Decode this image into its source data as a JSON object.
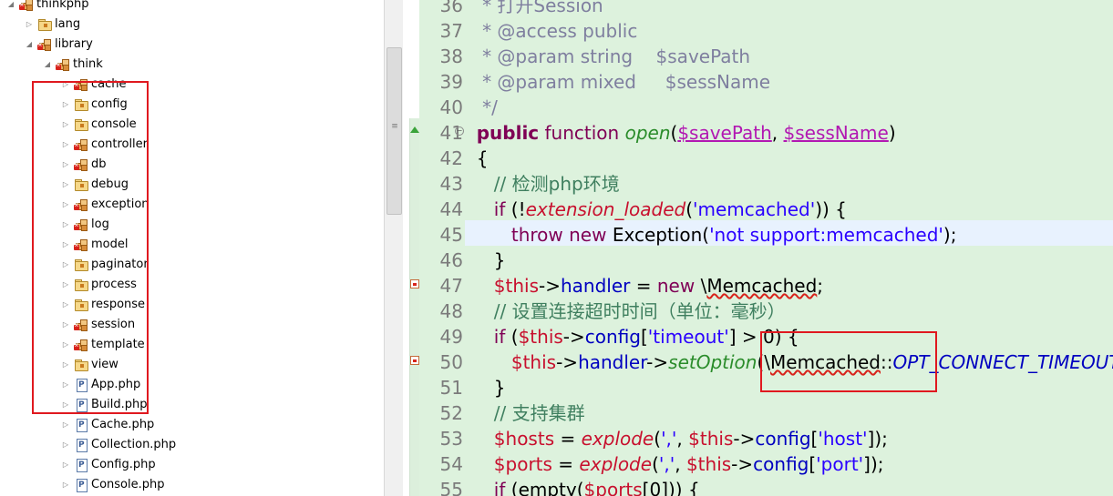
{
  "tree": {
    "rows": [
      {
        "label": "thinkphp",
        "twisty": "◢",
        "icon": "package",
        "error": true,
        "level": 0
      },
      {
        "label": "lang",
        "twisty": "▷",
        "icon": "folder",
        "error": false,
        "level": 1
      },
      {
        "label": "library",
        "twisty": "◢",
        "icon": "package",
        "error": true,
        "level": 1
      },
      {
        "label": "think",
        "twisty": "◢",
        "icon": "package",
        "error": true,
        "level": 2
      },
      {
        "label": "cache",
        "twisty": "▷",
        "icon": "package",
        "error": true,
        "level": 3
      },
      {
        "label": "config",
        "twisty": "▷",
        "icon": "folder",
        "error": false,
        "level": 3
      },
      {
        "label": "console",
        "twisty": "▷",
        "icon": "folder",
        "error": false,
        "level": 3
      },
      {
        "label": "controller",
        "twisty": "▷",
        "icon": "package",
        "error": true,
        "level": 3
      },
      {
        "label": "db",
        "twisty": "▷",
        "icon": "package",
        "error": true,
        "level": 3
      },
      {
        "label": "debug",
        "twisty": "▷",
        "icon": "folder",
        "error": false,
        "level": 3
      },
      {
        "label": "exception",
        "twisty": "▷",
        "icon": "package",
        "error": true,
        "level": 3
      },
      {
        "label": "log",
        "twisty": "▷",
        "icon": "package",
        "error": true,
        "level": 3
      },
      {
        "label": "model",
        "twisty": "▷",
        "icon": "package",
        "error": true,
        "level": 3
      },
      {
        "label": "paginator",
        "twisty": "▷",
        "icon": "folder",
        "error": false,
        "level": 3
      },
      {
        "label": "process",
        "twisty": "▷",
        "icon": "folder",
        "error": false,
        "level": 3
      },
      {
        "label": "response",
        "twisty": "▷",
        "icon": "folder",
        "error": false,
        "level": 3
      },
      {
        "label": "session",
        "twisty": "▷",
        "icon": "package",
        "error": true,
        "level": 3
      },
      {
        "label": "template",
        "twisty": "▷",
        "icon": "package",
        "error": true,
        "level": 3
      },
      {
        "label": "view",
        "twisty": "▷",
        "icon": "folder",
        "error": false,
        "level": 3
      },
      {
        "label": "App.php",
        "twisty": "▷",
        "icon": "php-file",
        "error": false,
        "level": 3
      },
      {
        "label": "Build.php",
        "twisty": "▷",
        "icon": "php-file",
        "error": false,
        "level": 3
      },
      {
        "label": "Cache.php",
        "twisty": "▷",
        "icon": "php-file",
        "error": false,
        "level": 3
      },
      {
        "label": "Collection.php",
        "twisty": "▷",
        "icon": "php-file",
        "error": false,
        "level": 3
      },
      {
        "label": "Config.php",
        "twisty": "▷",
        "icon": "php-file",
        "error": false,
        "level": 3
      },
      {
        "label": "Console.php",
        "twisty": "▷",
        "icon": "php-file",
        "error": false,
        "level": 3
      }
    ]
  },
  "editor": {
    "lines": [
      {
        "n": "36",
        "tokens": [
          {
            "t": "   * 打开Session",
            "c": "c-comd"
          }
        ]
      },
      {
        "n": "37",
        "tokens": [
          {
            "t": "   * @access public",
            "c": "c-comd"
          }
        ]
      },
      {
        "n": "38",
        "tokens": [
          {
            "t": "   * @param string    $savePath",
            "c": "c-comd"
          }
        ]
      },
      {
        "n": "39",
        "tokens": [
          {
            "t": "   * @param mixed     $sessName",
            "c": "c-comd"
          }
        ]
      },
      {
        "n": "40",
        "tokens": [
          {
            "t": "   */",
            "c": "c-comd"
          }
        ]
      },
      {
        "n": "41",
        "tokens": [
          {
            "t": "  ",
            "c": "c-pl"
          },
          {
            "t": "public",
            "c": "c-kw"
          },
          {
            "t": " ",
            "c": "c-pl"
          },
          {
            "t": "function",
            "c": "c-kw2"
          },
          {
            "t": " ",
            "c": "c-pl"
          },
          {
            "t": "open",
            "c": "c-fn"
          },
          {
            "t": "(",
            "c": "c-pl"
          },
          {
            "t": "$savePath",
            "c": "c-var"
          },
          {
            "t": ", ",
            "c": "c-pl"
          },
          {
            "t": "$sessName",
            "c": "c-var"
          },
          {
            "t": ")",
            "c": "c-pl"
          }
        ]
      },
      {
        "n": "42",
        "tokens": [
          {
            "t": "  {",
            "c": "c-pl"
          }
        ]
      },
      {
        "n": "43",
        "tokens": [
          {
            "t": "     ",
            "c": "c-pl"
          },
          {
            "t": "// 检测php环境",
            "c": "c-com"
          }
        ]
      },
      {
        "n": "44",
        "tokens": [
          {
            "t": "     ",
            "c": "c-pl"
          },
          {
            "t": "if",
            "c": "c-kw2"
          },
          {
            "t": " (!",
            "c": "c-pl"
          },
          {
            "t": "extension_loaded",
            "c": "c-call"
          },
          {
            "t": "(",
            "c": "c-pl"
          },
          {
            "t": "'memcached'",
            "c": "c-str"
          },
          {
            "t": ")) {",
            "c": "c-pl"
          }
        ]
      },
      {
        "n": "45",
        "tokens": [
          {
            "t": "        ",
            "c": "c-pl"
          },
          {
            "t": "throw",
            "c": "c-kw2"
          },
          {
            "t": " ",
            "c": "c-pl"
          },
          {
            "t": "new",
            "c": "c-kw2"
          },
          {
            "t": " Exception(",
            "c": "c-pl"
          },
          {
            "t": "'not support:memcached'",
            "c": "c-str"
          },
          {
            "t": ");",
            "c": "c-pl"
          }
        ]
      },
      {
        "n": "46",
        "tokens": [
          {
            "t": "     }",
            "c": "c-pl"
          }
        ]
      },
      {
        "n": "47",
        "tokens": [
          {
            "t": "     ",
            "c": "c-pl"
          },
          {
            "t": "$this",
            "c": "c-this"
          },
          {
            "t": "->",
            "c": "c-pl"
          },
          {
            "t": "handler",
            "c": "c-prop"
          },
          {
            "t": " = ",
            "c": "c-pl"
          },
          {
            "t": "new",
            "c": "c-kw2"
          },
          {
            "t": " \\",
            "c": "c-pl"
          },
          {
            "t": "Memcached",
            "c": "c-pl c-warn"
          },
          {
            "t": ";",
            "c": "c-pl"
          }
        ]
      },
      {
        "n": "48",
        "tokens": [
          {
            "t": "     ",
            "c": "c-pl"
          },
          {
            "t": "// 设置连接超时时间（单位：毫秒）",
            "c": "c-com"
          }
        ]
      },
      {
        "n": "49",
        "tokens": [
          {
            "t": "     ",
            "c": "c-pl"
          },
          {
            "t": "if",
            "c": "c-kw2"
          },
          {
            "t": " (",
            "c": "c-pl"
          },
          {
            "t": "$this",
            "c": "c-this"
          },
          {
            "t": "->",
            "c": "c-pl"
          },
          {
            "t": "config",
            "c": "c-prop"
          },
          {
            "t": "[",
            "c": "c-pl"
          },
          {
            "t": "'timeout'",
            "c": "c-str"
          },
          {
            "t": "] > 0) {",
            "c": "c-pl"
          }
        ]
      },
      {
        "n": "50",
        "tokens": [
          {
            "t": "        ",
            "c": "c-pl"
          },
          {
            "t": "$this",
            "c": "c-this"
          },
          {
            "t": "->",
            "c": "c-pl"
          },
          {
            "t": "handler",
            "c": "c-prop"
          },
          {
            "t": "->",
            "c": "c-pl"
          },
          {
            "t": "setOption",
            "c": "c-fn"
          },
          {
            "t": "(\\",
            "c": "c-pl"
          },
          {
            "t": "Memcached",
            "c": "c-pl c-warn"
          },
          {
            "t": "::",
            "c": "c-pl"
          },
          {
            "t": "OPT_CONNECT_TIMEOUT",
            "c": "c-const"
          }
        ]
      },
      {
        "n": "51",
        "tokens": [
          {
            "t": "     }",
            "c": "c-pl"
          }
        ]
      },
      {
        "n": "52",
        "tokens": [
          {
            "t": "     ",
            "c": "c-pl"
          },
          {
            "t": "// 支持集群",
            "c": "c-com"
          }
        ]
      },
      {
        "n": "53",
        "tokens": [
          {
            "t": "     ",
            "c": "c-pl"
          },
          {
            "t": "$hosts",
            "c": "c-this"
          },
          {
            "t": " = ",
            "c": "c-pl"
          },
          {
            "t": "explode",
            "c": "c-call"
          },
          {
            "t": "(",
            "c": "c-pl"
          },
          {
            "t": "','",
            "c": "c-str"
          },
          {
            "t": ", ",
            "c": "c-pl"
          },
          {
            "t": "$this",
            "c": "c-this"
          },
          {
            "t": "->",
            "c": "c-pl"
          },
          {
            "t": "config",
            "c": "c-prop"
          },
          {
            "t": "[",
            "c": "c-pl"
          },
          {
            "t": "'host'",
            "c": "c-str"
          },
          {
            "t": "]);",
            "c": "c-pl"
          }
        ]
      },
      {
        "n": "54",
        "tokens": [
          {
            "t": "     ",
            "c": "c-pl"
          },
          {
            "t": "$ports",
            "c": "c-this"
          },
          {
            "t": " = ",
            "c": "c-pl"
          },
          {
            "t": "explode",
            "c": "c-call"
          },
          {
            "t": "(",
            "c": "c-pl"
          },
          {
            "t": "','",
            "c": "c-str"
          },
          {
            "t": ", ",
            "c": "c-pl"
          },
          {
            "t": "$this",
            "c": "c-this"
          },
          {
            "t": "->",
            "c": "c-pl"
          },
          {
            "t": "config",
            "c": "c-prop"
          },
          {
            "t": "[",
            "c": "c-pl"
          },
          {
            "t": "'port'",
            "c": "c-str"
          },
          {
            "t": "]);",
            "c": "c-pl"
          }
        ]
      },
      {
        "n": "55",
        "tokens": [
          {
            "t": "     ",
            "c": "c-pl"
          },
          {
            "t": "if",
            "c": "c-kw2"
          },
          {
            "t": " (empty(",
            "c": "c-pl"
          },
          {
            "t": "$ports",
            "c": "c-this"
          },
          {
            "t": "[0])) {",
            "c": "c-pl"
          }
        ]
      }
    ]
  }
}
